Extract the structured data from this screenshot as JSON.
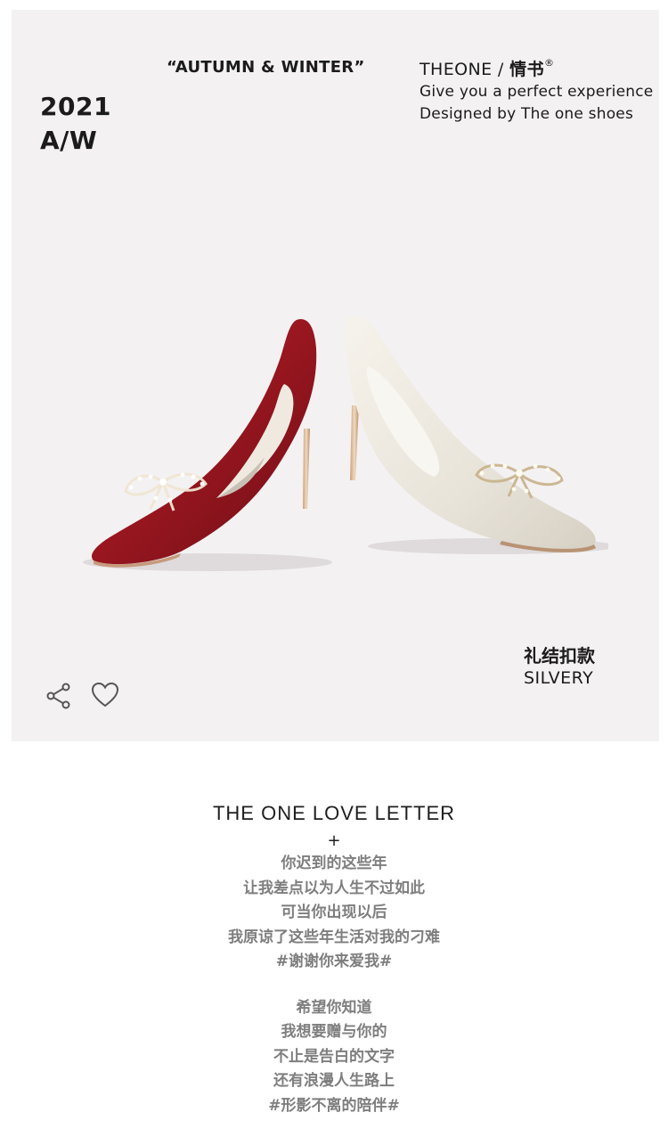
{
  "hero": {
    "year": "2021",
    "season_code": "A/W",
    "season_tag": "“AUTUMN & WINTER”",
    "brand_name": "THEONE",
    "brand_sep": " / ",
    "brand_cn": "情书",
    "brand_reg": "®",
    "tagline_1": "Give you a perfect experience",
    "tagline_2": "Designed by The one shoes",
    "product_cn": "礼结扣款",
    "product_en": "SILVERY",
    "actions": {
      "share_icon": "share-icon",
      "like_icon": "heart-icon"
    },
    "colors": {
      "background": "#f3f1f2",
      "red_shoe": "#9e1c23",
      "white_shoe": "#ece8df"
    }
  },
  "letter": {
    "title": "THE ONE LOVE LETTER",
    "plus": "+",
    "stanza_1": [
      "你迟到的这些年",
      "让我差点以为人生不过如此",
      "可当你出现以后",
      "我原谅了这些年生活对我的刁难",
      "#谢谢你来爱我#"
    ],
    "stanza_2": [
      "希望你知道",
      "我想要赠与你的",
      "不止是告白的文字",
      "还有浪漫人生路上",
      "#形影不离的陪伴#"
    ]
  }
}
